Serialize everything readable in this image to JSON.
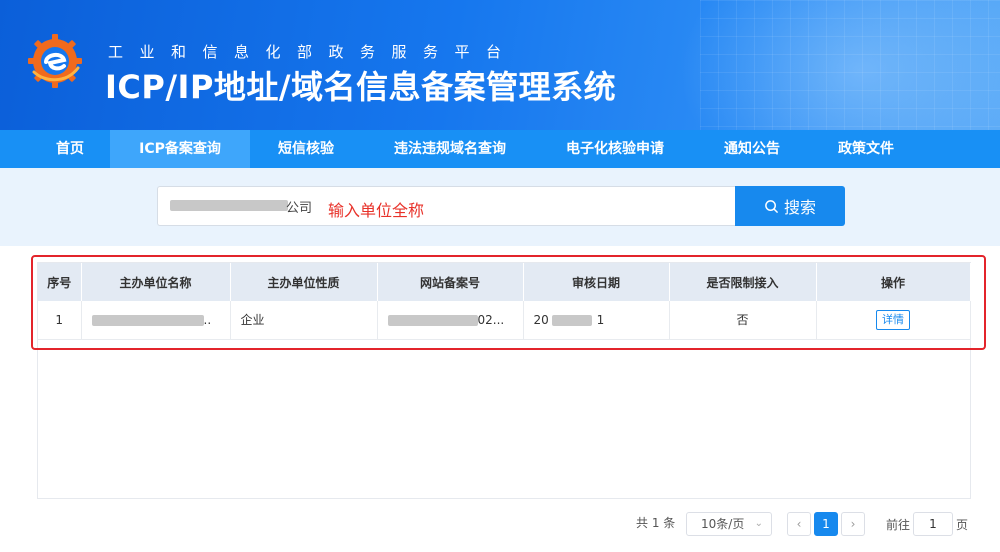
{
  "header": {
    "subtitle": "工业和信息化部政务服务平台",
    "title": "ICP/IP地址/域名信息备案管理系统"
  },
  "nav": {
    "items": [
      {
        "label": "首页",
        "active": false
      },
      {
        "label": "ICP备案查询",
        "active": true
      },
      {
        "label": "短信核验",
        "active": false
      },
      {
        "label": "违法违规域名查询",
        "active": false
      },
      {
        "label": "电子化核验申请",
        "active": false
      },
      {
        "label": "通知公告",
        "active": false
      },
      {
        "label": "政策文件",
        "active": false
      }
    ]
  },
  "search": {
    "value": "公司",
    "hint": "输入单位全称",
    "button_label": "搜索"
  },
  "table": {
    "columns": [
      "序号",
      "主办单位名称",
      "主办单位性质",
      "网站备案号",
      "审核日期",
      "是否限制接入",
      "操作"
    ],
    "rows": [
      {
        "index": "1",
        "org_name": "..",
        "org_type": "企业",
        "record_no": "02...",
        "review_date_start": "20",
        "review_date_end": "1",
        "restricted": "否",
        "action": "详情"
      }
    ]
  },
  "pagination": {
    "total_text": "共 1 条",
    "page_size": "10条/页",
    "current_page": "1",
    "goto_label": "前往",
    "goto_value": "1",
    "page_suffix": "页",
    "prev_icon": "chevron-left-icon",
    "next_icon": "chevron-right-icon"
  },
  "colors": {
    "header_blue": "#1677ee",
    "nav_blue": "#1890f5",
    "nav_active": "#3ea6fb",
    "button_blue": "#1789ee",
    "highlight_red": "#e3242b",
    "hint_red": "#e8322a"
  }
}
